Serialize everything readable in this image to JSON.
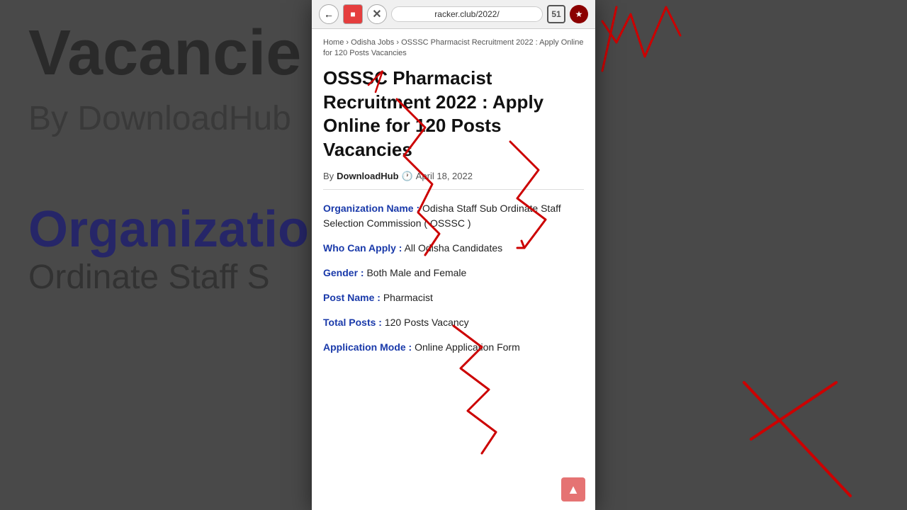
{
  "background": {
    "title": "Vacancie",
    "by_text": "By DownloadHub",
    "org_label": "Organization N",
    "org_text": "Ordinate Staff S"
  },
  "browser": {
    "url": "racker.club/2022/",
    "tab_count": "51",
    "back_icon": "←",
    "stop_icon": "■",
    "close_icon": "✕"
  },
  "breadcrumb": {
    "home": "Home",
    "separator1": "›",
    "odisha": "Odisha Jobs",
    "separator2": "›",
    "current": "OSSSC Pharmacist Recruitment 2022 : Apply Online for 120 Posts Vacancies"
  },
  "article": {
    "title": "OSSSC Pharmacist Recruitment 2022 : Apply Online for 120 Posts Vacancies",
    "author": "DownloadHub",
    "date": "April 18, 2022",
    "by_label": "By"
  },
  "details": {
    "org_label": "Organization Name :",
    "org_value": "Odisha Staff Sub Ordinate Staff Selection Commission ( OSSSC )",
    "who_label": "Who Can Apply :",
    "who_value": "All Odisha Candidates",
    "gender_label": "Gender :",
    "gender_value": "Both Male and Female",
    "post_label": "Post Name :",
    "post_value": "Pharmacist",
    "total_label": "Total Posts :",
    "total_value": "120 Posts Vacancy",
    "app_mode_label": "Application Mode :",
    "app_mode_value": "Online Application Form"
  },
  "scroll_top_icon": "▲"
}
